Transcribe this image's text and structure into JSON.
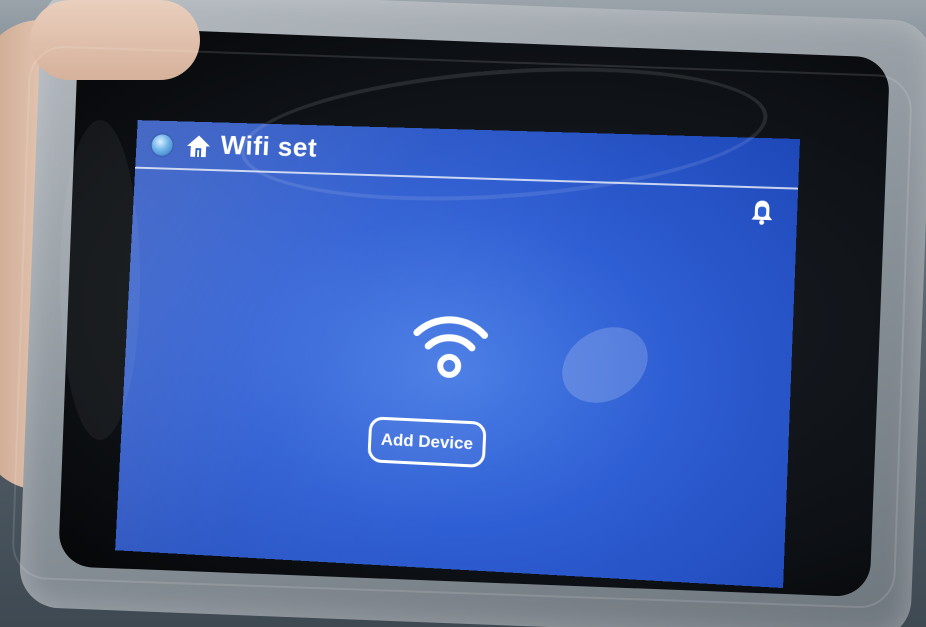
{
  "screen": {
    "title": "Wifi set",
    "add_device_label": "Add Device"
  },
  "icons": {
    "back": "back-globe-icon",
    "home": "home-icon",
    "notification": "bell-icon",
    "wifi": "wifi-icon"
  },
  "colors": {
    "screen_blue": "#2f5fd4",
    "foreground": "#ffffff"
  }
}
